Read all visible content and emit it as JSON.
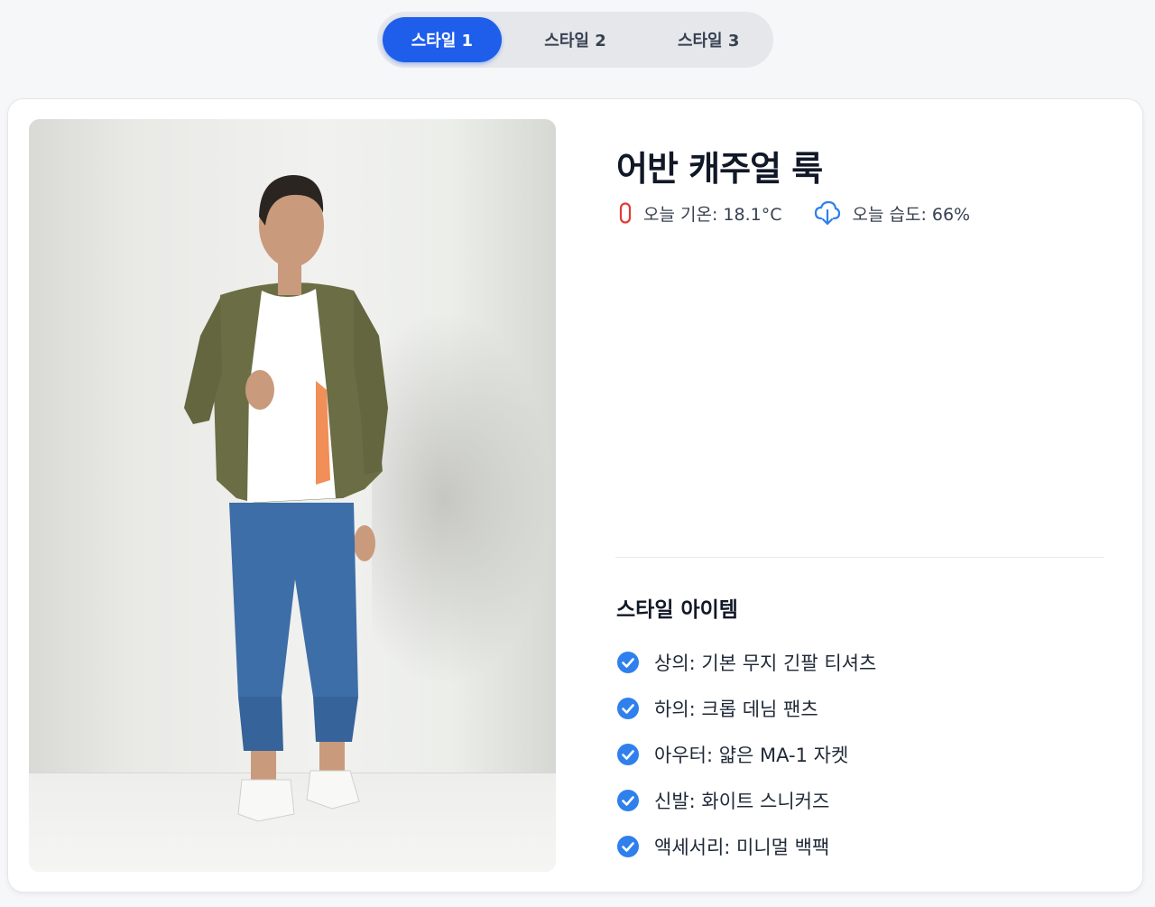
{
  "tabs": [
    {
      "label": "스타일 1",
      "active": true
    },
    {
      "label": "스타일 2",
      "active": false
    },
    {
      "label": "스타일 3",
      "active": false
    }
  ],
  "outfit": {
    "title": "어반 캐주얼 룩",
    "weather": {
      "temperature_label": "오늘 기온: 18.1°C",
      "humidity_label": "오늘 습도: 66%"
    },
    "items_title": "스타일 아이템",
    "items": [
      "상의: 기본 무지 긴팔 티셔츠",
      "하의: 크롭 데님 팬츠",
      "아우터: 얇은 MA-1 자켓",
      "신발: 화이트 스니커즈",
      "액세서리: 미니멀 백팩"
    ]
  },
  "icons": {
    "temperature": "thermometer-icon",
    "humidity": "cloud-download-icon",
    "item": "check-circle-icon"
  },
  "colors": {
    "accent": "#1e5eea",
    "check": "#2f80ed",
    "thermometer": "#e53935",
    "humidity_icon": "#2f80ed"
  }
}
